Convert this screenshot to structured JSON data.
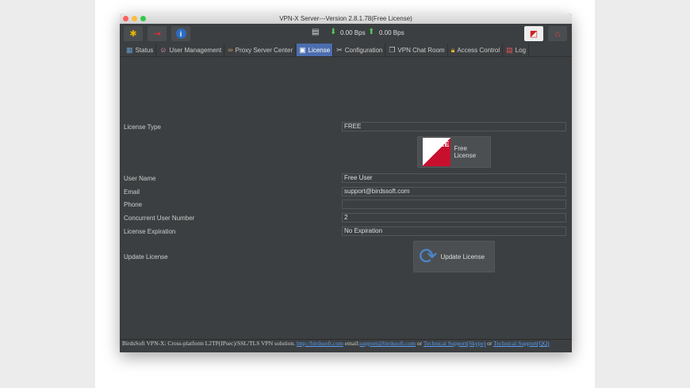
{
  "window": {
    "title": "VPN-X Server---Version 2.8.1.78(Free License)"
  },
  "toolbar": {
    "download_speed": "0.00 Bps",
    "upload_speed": "0.00 Bps"
  },
  "tabs": [
    {
      "label": "Status",
      "icon": "status-icon"
    },
    {
      "label": "User Management",
      "icon": "users-icon"
    },
    {
      "label": "Proxy Server Center",
      "icon": "chain-icon"
    },
    {
      "label": "License",
      "icon": "license-icon",
      "active": true
    },
    {
      "label": "Configuration",
      "icon": "tools-icon"
    },
    {
      "label": "VPN Chat Room",
      "icon": "chat-icon"
    },
    {
      "label": "Access Control",
      "icon": "lock-icon"
    },
    {
      "label": "Log",
      "icon": "log-icon"
    }
  ],
  "license": {
    "type_label": "License Type",
    "type_value": "FREE",
    "free_button": "Free License",
    "free_badge": "FREE",
    "user_label": "User Name",
    "user_value": "Free User",
    "email_label": "Email",
    "email_value": "support@birdssoft.com",
    "phone_label": "Phone",
    "phone_value": "",
    "concurrent_label": "Concurrent User Number",
    "concurrent_value": "2",
    "expiration_label": "License Expiration",
    "expiration_value": "No Expiration",
    "update_label": "Update License",
    "update_button": "Update License"
  },
  "footer": {
    "text": "BirdsSoft VPN-X: Cross-platform L2TP(IPsec)/SSL/TLS VPN solution.",
    "link1": "http://birdssoft.com",
    "email_prefix": "email:",
    "link2": "support@birdssoft.com",
    "or1": "or",
    "link3": "Technical Support(Skype)",
    "or2": "or",
    "link4": "Technical Support(QQ)"
  }
}
